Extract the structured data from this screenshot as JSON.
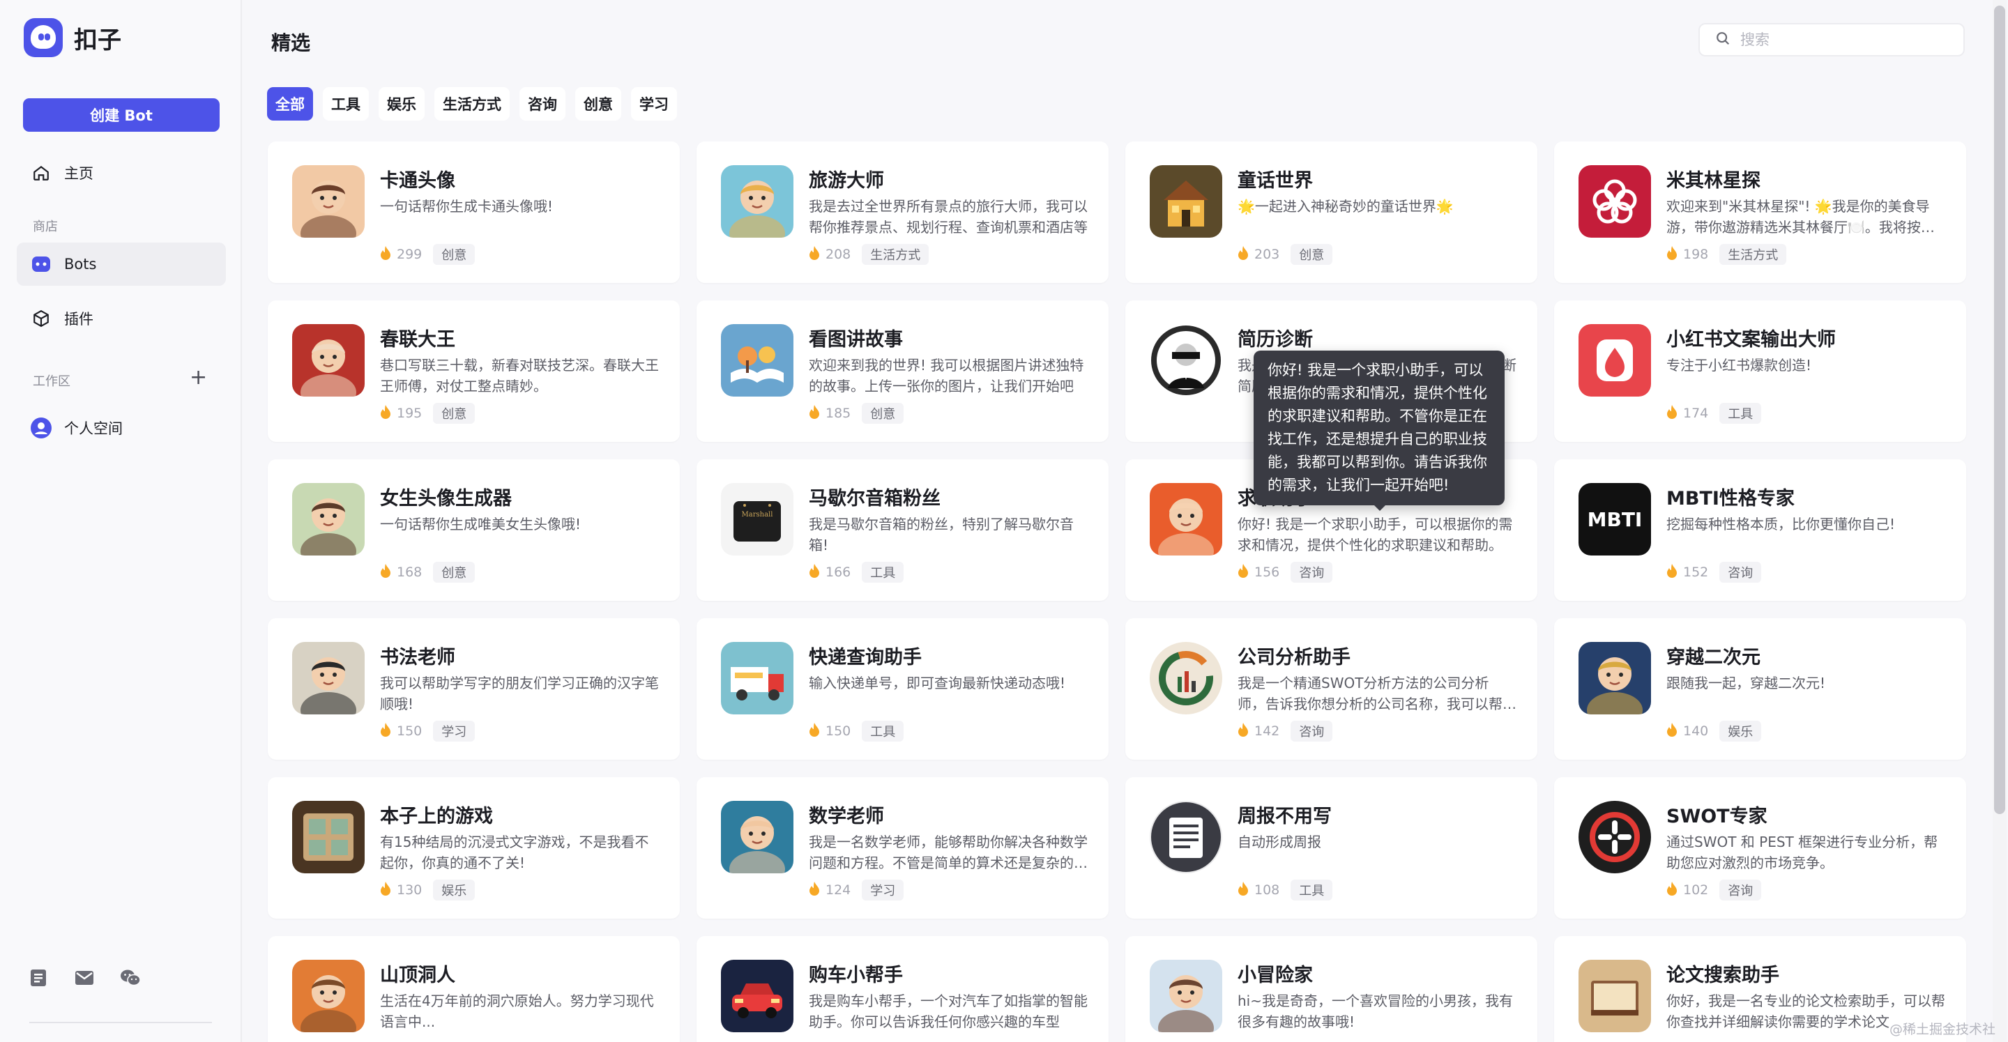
{
  "app": {
    "name": "扣子"
  },
  "sidebar": {
    "create_label": "创建 Bot",
    "home_label": "主页",
    "store_label": "商店",
    "bots_label": "Bots",
    "plugins_label": "插件",
    "workspace_label": "工作区",
    "personal_label": "个人空间",
    "bottom_icons": [
      "document-icon",
      "mail-icon",
      "wechat-icon"
    ]
  },
  "header": {
    "title": "精选",
    "search_placeholder": "搜索"
  },
  "tabs": [
    {
      "label": "全部",
      "active": true
    },
    {
      "label": "工具",
      "active": false
    },
    {
      "label": "娱乐",
      "active": false
    },
    {
      "label": "生活方式",
      "active": false
    },
    {
      "label": "咨询",
      "active": false
    },
    {
      "label": "创意",
      "active": false
    },
    {
      "label": "学习",
      "active": false
    }
  ],
  "bots": [
    {
      "name": "卡通头像",
      "desc": "一句话帮你生成卡通头像哦!",
      "count": "299",
      "tag": "创意"
    },
    {
      "name": "旅游大师",
      "desc": "我是去过全世界所有景点的旅行大师，我可以帮你推荐景点、规划行程、查询机票和酒店等",
      "count": "208",
      "tag": "生活方式"
    },
    {
      "name": "童话世界",
      "desc": "🌟一起进入神秘奇妙的童话世界🌟",
      "count": "203",
      "tag": "创意"
    },
    {
      "name": "米其林星探",
      "desc": "欢迎来到\"米其林星探\"! 🌟我是你的美食导游，带你遨游精选米其林餐厅🍽️。我将按照您的要求推荐",
      "count": "198",
      "tag": "生活方式"
    },
    {
      "name": "春联大王",
      "desc": "巷口写联三十载，新春对联技艺深。春联大王王师傅，对仗工整点睛妙。",
      "count": "195",
      "tag": "创意"
    },
    {
      "name": "看图讲故事",
      "desc": "欢迎来到我的世界! 我可以根据图片讲述独特的故事。上传一张你的图片，让我们开始吧",
      "count": "185",
      "tag": "创意"
    },
    {
      "name": "简历诊断",
      "desc": "我是一名专业的简历诊断师，可以帮助你诊断简历",
      "count": "",
      "tag": ""
    },
    {
      "name": "小红书文案输出大师",
      "desc": "专注于小红书爆款创造!",
      "count": "174",
      "tag": "工具"
    },
    {
      "name": "女生头像生成器",
      "desc": "一句话帮你生成唯美女生头像哦!",
      "count": "168",
      "tag": "创意"
    },
    {
      "name": "马歇尔音箱粉丝",
      "desc": "我是马歇尔音箱的粉丝，特别了解马歇尔音箱!",
      "count": "166",
      "tag": "工具"
    },
    {
      "name": "求职助手",
      "desc": "你好! 我是一个求职小助手，可以根据你的需求和情况，提供个性化的求职建议和帮助。",
      "count": "156",
      "tag": "咨询"
    },
    {
      "name": "MBTI性格专家",
      "desc": "挖掘每种性格本质，比你更懂你自己!",
      "count": "152",
      "tag": "咨询"
    },
    {
      "name": "书法老师",
      "desc": "我可以帮助学写字的朋友们学习正确的汉字笔顺哦!",
      "count": "150",
      "tag": "学习"
    },
    {
      "name": "快递查询助手",
      "desc": "输入快递单号，即可查询最新快递动态哦!",
      "count": "150",
      "tag": "工具"
    },
    {
      "name": "公司分析助手",
      "desc": "我是一个精通SWOT分析方法的公司分析师，告诉我你想分析的公司名称，我可以帮你分析",
      "count": "142",
      "tag": "咨询"
    },
    {
      "name": "穿越二次元",
      "desc": "跟随我一起，穿越二次元!",
      "count": "140",
      "tag": "娱乐"
    },
    {
      "name": "本子上的游戏",
      "desc": "有15种结局的沉浸式文字游戏，不是我看不起你，你真的通不了关!",
      "count": "130",
      "tag": "娱乐"
    },
    {
      "name": "数学老师",
      "desc": "我是一名数学老师，能够帮助你解决各种数学问题和方程。不管是简单的算术还是复杂的方程",
      "count": "124",
      "tag": "学习"
    },
    {
      "name": "周报不用写",
      "desc": "自动形成周报",
      "count": "108",
      "tag": "工具"
    },
    {
      "name": "SWOT专家",
      "desc": "通过SWOT 和 PEST 框架进行专业分析，帮助您应对激烈的市场竞争。",
      "count": "102",
      "tag": "咨询"
    },
    {
      "name": "山顶洞人",
      "desc": "生活在4万年前的洞穴原始人。努力学习现代语言中...",
      "count": "",
      "tag": ""
    },
    {
      "name": "购车小帮手",
      "desc": "我是购车小帮手，一个对汽车了如指掌的智能助手。你可以告诉我任何你感兴趣的车型",
      "count": "",
      "tag": ""
    },
    {
      "name": "小冒险家",
      "desc": "hi~我是奇奇，一个喜欢冒险的小男孩，我有很多有趣的故事哦!",
      "count": "",
      "tag": ""
    },
    {
      "name": "论文搜索助手",
      "desc": "你好，我是一名专业的论文检索助手，可以帮你查找并详细解读你需要的学术论文",
      "count": "",
      "tag": ""
    }
  ],
  "tooltip": {
    "text": "你好! 我是一个求职小助手，可以根据你的需求和情况，提供个性化的求职建议和帮助。不管你是正在找工作，还是想提升自己的职业技能，我都可以帮到你。请告诉我你的需求，让我们一起开始吧!"
  },
  "watermark": "@稀土掘金技术社区",
  "colors": {
    "accent": "#4d53e8",
    "flame": "#f7a825"
  }
}
